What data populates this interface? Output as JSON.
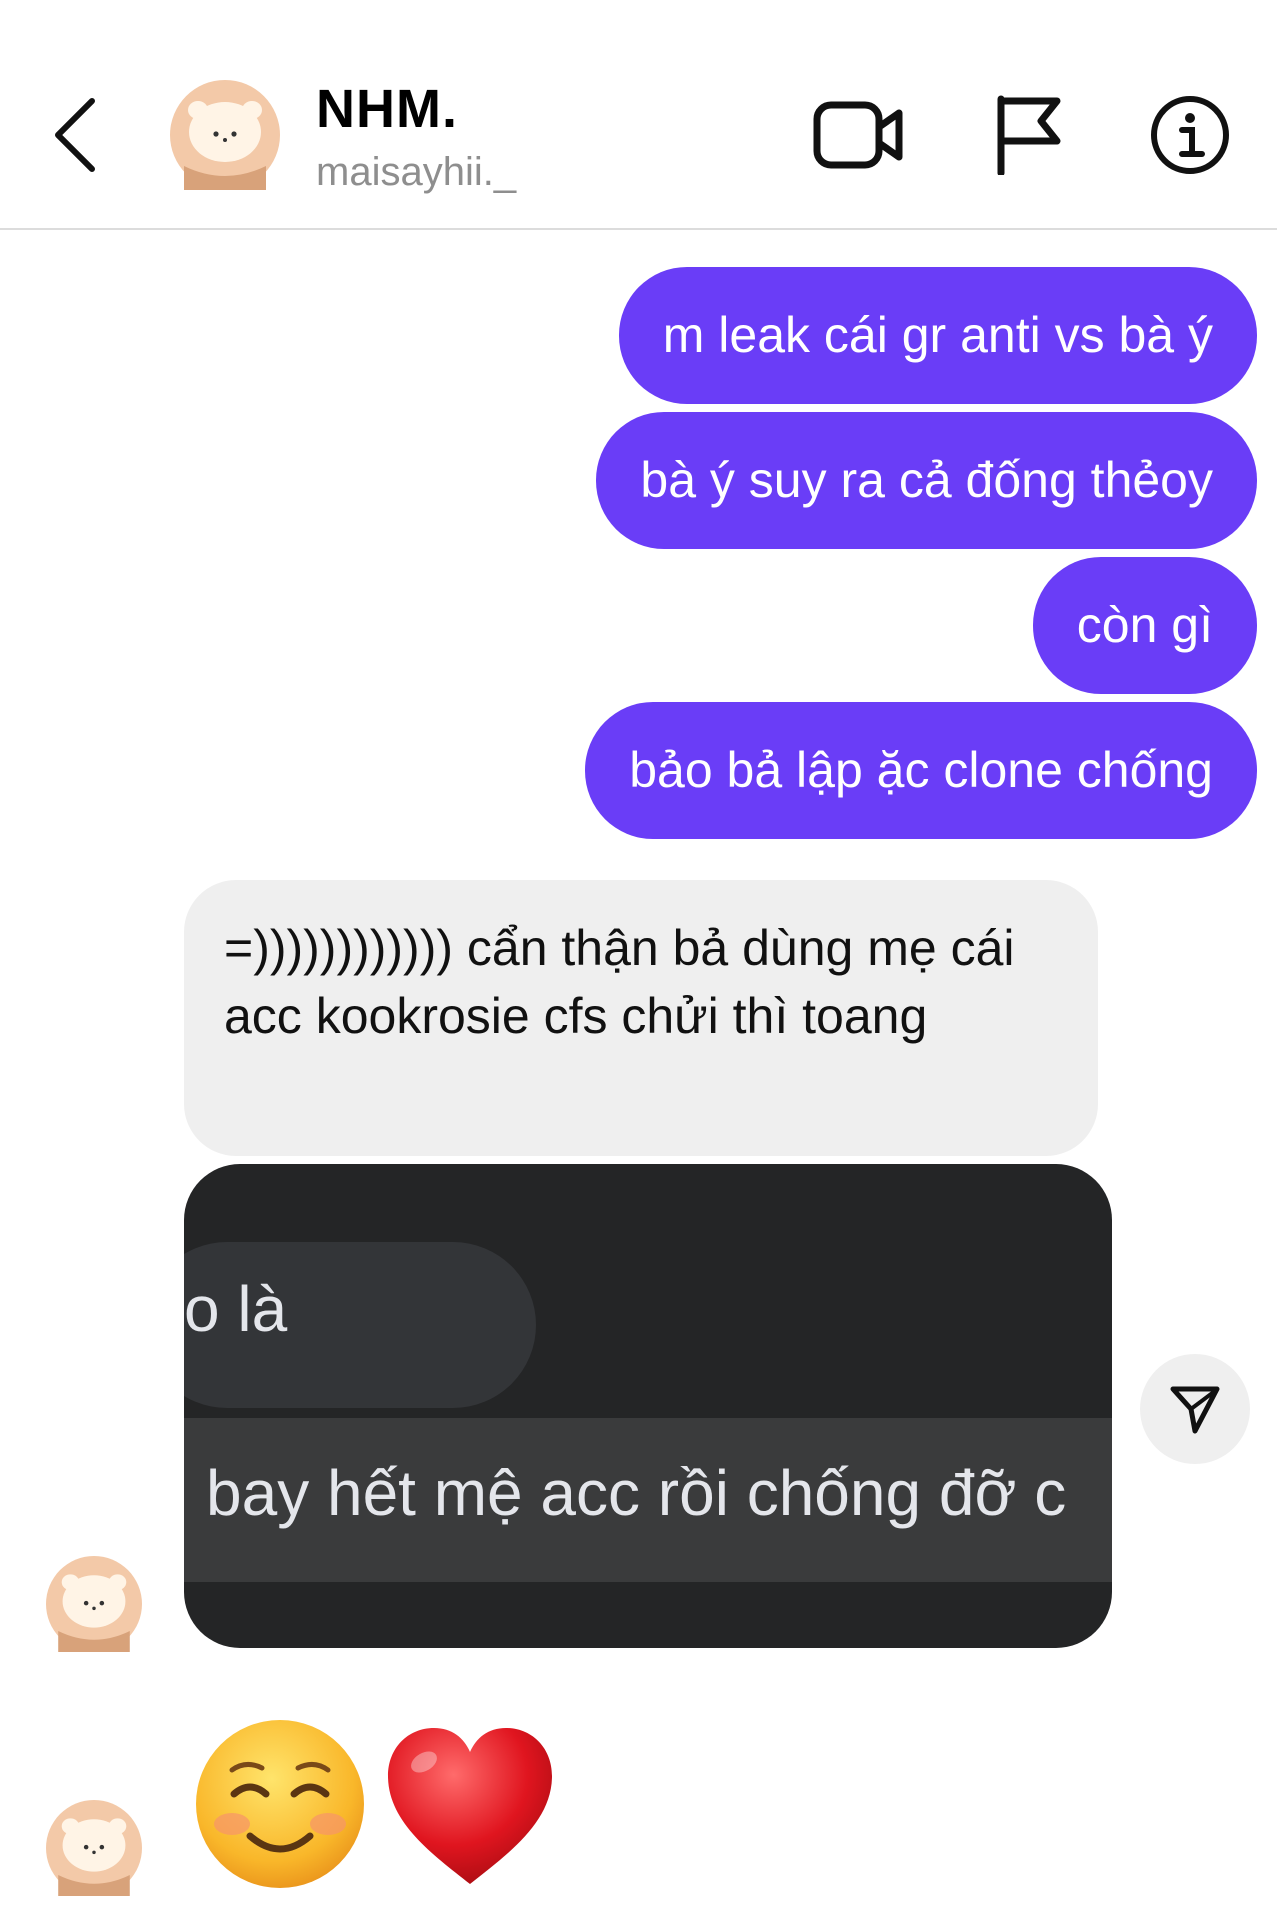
{
  "header": {
    "contact_name": "NHM.",
    "contact_username": "maisayhii._",
    "icons": {
      "back": "chevron-left-icon",
      "video": "video-camera-icon",
      "report": "flag-icon",
      "info": "info-icon"
    }
  },
  "messages": {
    "outgoing": [
      "m leak cái gr anti vs bà ý",
      "bà ý suy ra cả đống thẻoy",
      "còn gì",
      "bảo bả lập ặc clone chống"
    ],
    "incoming_text": "=)))))))))))) cẩn thận bả dùng mẹ cái acc kookrosie cfs chửi thì toang",
    "shared_screenshot": {
      "line1": "o là",
      "line2": "bay hết mệ acc rồi chống đỡ c"
    },
    "reactions_emoji": [
      "smiling-face-icon",
      "red-heart-icon"
    ]
  },
  "colors": {
    "outgoing_bubble": "#6a3df7",
    "incoming_bubble": "#efefef",
    "media_background": "#242526"
  }
}
